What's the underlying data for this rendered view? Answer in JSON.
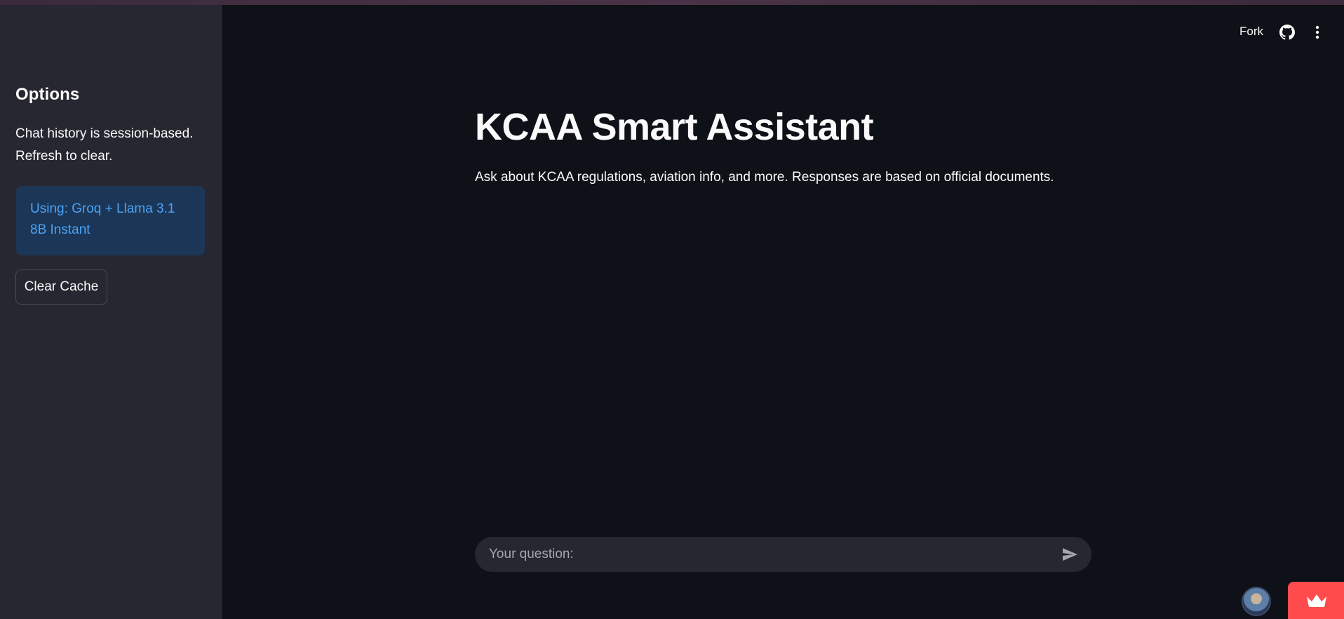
{
  "sidebar": {
    "heading": "Options",
    "description": "Chat history is session-based. Refresh to clear.",
    "model_info": "Using: Groq + Llama 3.1 8B Instant",
    "clear_button_label": "Clear Cache"
  },
  "header": {
    "fork_label": "Fork",
    "github_icon": "github-icon",
    "menu_icon": "kebab-menu-icon"
  },
  "main": {
    "title": "KCAA Smart Assistant",
    "subtitle": "Ask about KCAA regulations, aviation info, and more. Responses are based on official documents."
  },
  "chat": {
    "placeholder": "Your question:",
    "value": "",
    "send_icon": "send-icon"
  },
  "footer": {
    "avatar_icon": "user-avatar",
    "badge_icon": "crown-icon"
  },
  "colors": {
    "background": "#0e1117",
    "sidebar": "#262730",
    "info_bg": "#1c3657",
    "info_text": "#4aa3f5",
    "badge": "#ff4b4b"
  }
}
